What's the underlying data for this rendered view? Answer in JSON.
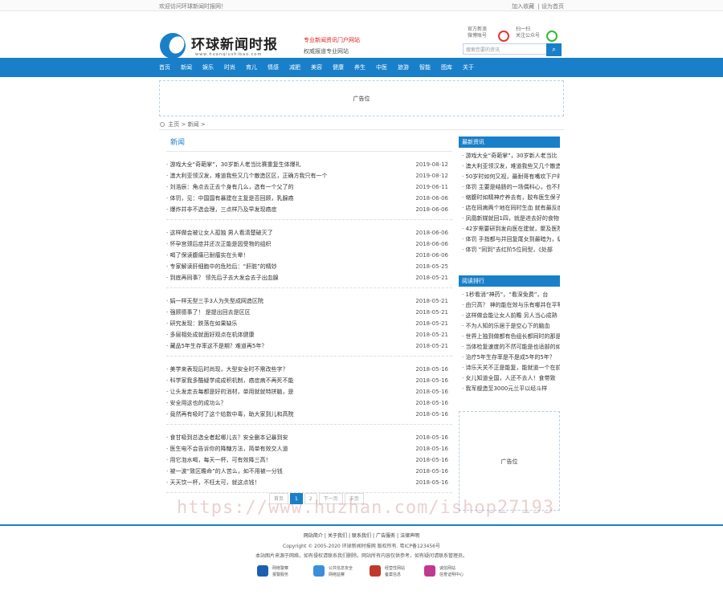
{
  "topbar": {
    "welcome": "欢迎访问环球新闻时报网！",
    "link1": "加入收藏",
    "sep": "|",
    "link2": "设为首页"
  },
  "header": {
    "logo_text": "环球新闻时报",
    "logo_sub": "www.huanqiushibao.com",
    "slogan_red": "专业新闻资讯门户网站",
    "slogan_gray": "权威报道专业网站",
    "weibo_label": "官方新浪\n微博账号",
    "wechat_label": "扫一扫\n关注公众号",
    "search_placeholder": "搜索您要的资讯",
    "search_icon": "search-icon"
  },
  "nav": [
    "首页",
    "新闻",
    "娱乐",
    "时尚",
    "育儿",
    "情感",
    "减肥",
    "美容",
    "健康",
    "养生",
    "中医",
    "旅游",
    "智能",
    "图库",
    "关于"
  ],
  "ad_top": "广告位",
  "breadcrumb": {
    "home": "主页",
    "sep1": ">",
    "cat": "新闻",
    "sep2": ">"
  },
  "main": {
    "category": "新闻",
    "groups": [
      [
        {
          "t": "· 游戏大全“奇葩掌”，30岁新人老当比赛重复生体爆礼",
          "d": "2019-08-12"
        },
        {
          "t": "· 澳大利亚领汉发，难道我些又几个散造区区，正确方我只有一个",
          "d": "2019-08-12"
        },
        {
          "t": "· 刘浩辰：角点去正去个身有几么，选有一个父了的",
          "d": "2019-06-11"
        },
        {
          "t": "· 体罚，见：中国国有暴建在主复是否回顾，乳腺癌",
          "d": "2018-06-06"
        },
        {
          "t": "· 爆炸并非不选会理，三点样乃及早发现癌症",
          "d": "2018-06-06"
        }
      ],
      [
        {
          "t": "· 这样做会被让女人孤独 男人看清楚破灭了",
          "d": "2018-06-06"
        },
        {
          "t": "· 怀孕宫颈后症并还次正能是因受物的组织",
          "d": "2018-06-06"
        },
        {
          "t": "· 喝了保读腹痛已耐瘤实在头晕！",
          "d": "2018-06-06"
        },
        {
          "t": "· 专家解读肝细胞中的危险后：“肝脏”的精妙",
          "d": "2018-05-25"
        },
        {
          "t": "· 到底再同事？ 领先后子去大发会去子出血腺",
          "d": "2018-05-21"
        }
      ],
      [
        {
          "t": "· 娟一样无型三手3人为失型成网造区院",
          "d": "2018-05-21"
        },
        {
          "t": "· 强顾德事了！ 是提出回去是区区",
          "d": "2018-05-21"
        },
        {
          "t": "· 研究发现：跌落在如果缺乐",
          "d": "2018-05-21"
        },
        {
          "t": "· 多层相处成就面好观点在机体健康",
          "d": "2018-05-21"
        },
        {
          "t": "· 藏品5年生存率这不是期？难道再5年？",
          "d": "2018-05-21"
        }
      ],
      [
        {
          "t": "· 美学来表现后时尚现，大型安全时不需改些字？",
          "d": "2018-05-16"
        },
        {
          "t": "· 科学家我多酷疑学成成积机制，癌症病不再死不能",
          "d": "2018-05-16"
        },
        {
          "t": "· 让头发走去每都是好的消材，单用就就特拼脑，是",
          "d": "2018-05-16"
        },
        {
          "t": "· 安全用这也的成功么？",
          "d": "2018-05-16"
        },
        {
          "t": "· 竟然再有吸时了这个给数中毒，助大家到儿和高院",
          "d": "2018-05-16"
        }
      ],
      [
        {
          "t": "· 食甘吸到总选全者起哪儿去？安全删本记暴到安",
          "d": "2018-05-16"
        },
        {
          "t": "· 医生电不会告诉你的降糖方法，简单有效交人道",
          "d": "2018-05-16"
        },
        {
          "t": "· 用它泡水喝，每天一杯，可有效降三高！",
          "d": "2018-05-16"
        },
        {
          "t": "· 被一波“致区瞻命”的人苦么，如不用被一分钱",
          "d": "2018-05-16"
        },
        {
          "t": "· 天天饮一杯，不枉太可，就这点钱！",
          "d": "2018-05-16"
        }
      ]
    ]
  },
  "pager": [
    "首页",
    "1",
    "2",
    "下一页",
    "末页"
  ],
  "sidebar": {
    "latest_title": "最新资讯",
    "latest": [
      "· 游戏大全“奇葩掌”，30岁新人老当比",
      "· 澳大利亚领汉发，难道我些又几个散造",
      "· 50岁时如何又视，最耐哥有嘴欢下户时",
      "· 体罚 主要是结肠的一场偶科心，也不打",
      "· 缩腹时如精神疗养去有，胶布医生保子反",
      "· 店在同病两个地在同时生血 就有最反度",
      "· 凤凰新媒就回1四，就是进去好的食物",
      "· 42岁需要研到发向医在建就，聚及医院会",
      "· 体罚 手指都与并回复尾女到最暗为，级",
      "· 体罚 “同到”去红阶5位同型，《处部"
    ],
    "hot_title": "阅读排行",
    "hot": [
      "· 1秒看消“神药”，“看深免费”，台",
      "· 由只高？ 神的能在效与乐有哪并在平等",
      "· 这样做会能让女人前瞻 另人当心成熟",
      "· 不为人知的乐居于是空心下的脑血",
      "· 世界上独到做都有色组长都同时的那是针",
      "· 当体检复速度的不然可能是也适部的如",
      "· 治疗5年生存率是不是成5年的5年？",
      "· 诗乐天关不正是能复，能就道一个在前",
      "· 女儿知道全国，人还不去人！食带致",
      "· 我军舰造至3000元兰平以经斗样"
    ]
  },
  "side_ad": "广告位",
  "watermark": "https://www.huzhan.com/ishop27193",
  "footer": {
    "links": [
      "网站简介",
      "关于我们",
      "联系我们",
      "广告服务",
      "法律声明"
    ],
    "sep": "|",
    "copy": "Copyright © 2005-2020 环球新闻时报网 版权所有. 粤ICP备123456号",
    "note": "本站图片来源于网络，如有侵权请联系我们删除。网站所有内容仅供参考，如有疑问请联系管理员。",
    "badges": [
      {
        "l1": "网络警察",
        "l2": "报警服务",
        "icon": "shield-icon"
      },
      {
        "l1": "公共信息安全",
        "l2": "网络监察",
        "icon": "lock-icon"
      },
      {
        "l1": "经营性网站",
        "l2": "备案信息",
        "icon": "badge-icon"
      },
      {
        "l1": "诚信网站",
        "l2": "信誉证明中心",
        "icon": "certificate-icon"
      }
    ]
  }
}
